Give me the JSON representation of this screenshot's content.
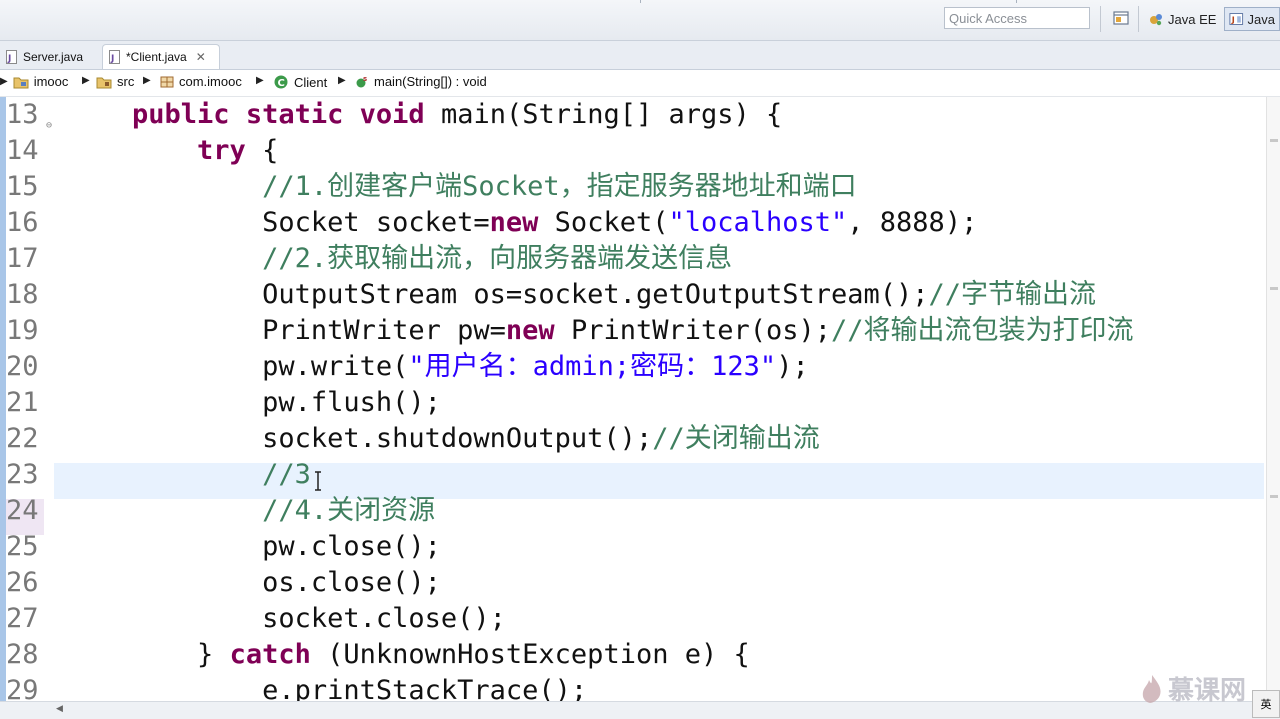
{
  "toolbar": {
    "quick_access_placeholder": "Quick Access",
    "perspectives": [
      {
        "label": "Java EE",
        "icon": "java-ee-perspective-icon",
        "active": false
      },
      {
        "label": "Java",
        "icon": "java-perspective-icon",
        "active": true
      }
    ]
  },
  "tabs": [
    {
      "label": "Server.java",
      "active": false
    },
    {
      "label": "*Client.java",
      "active": true,
      "close": "✕"
    }
  ],
  "breadcrumb": {
    "project": "imooc",
    "src": "src",
    "package": "com.imooc",
    "class": "Client",
    "method": "main(String[]) : void"
  },
  "editor": {
    "line_numbers": [
      "13",
      "14",
      "15",
      "16",
      "17",
      "18",
      "19",
      "20",
      "21",
      "22",
      "23",
      "24",
      "25",
      "26",
      "27",
      "28",
      "29"
    ],
    "lines": [
      [
        {
          "t": "    "
        },
        {
          "k": "kw",
          "t": "public"
        },
        {
          "t": " "
        },
        {
          "k": "kw",
          "t": "static"
        },
        {
          "t": " "
        },
        {
          "k": "kw",
          "t": "void"
        },
        {
          "t": " main(String[] args) {"
        }
      ],
      [
        {
          "t": "        "
        },
        {
          "k": "kw",
          "t": "try"
        },
        {
          "t": " {"
        }
      ],
      [
        {
          "t": "            "
        },
        {
          "k": "cm",
          "t": "//1.创建客户端Socket，指定服务器地址和端口"
        }
      ],
      [
        {
          "t": "            Socket socket="
        },
        {
          "k": "kw",
          "t": "new"
        },
        {
          "t": " Socket("
        },
        {
          "k": "str",
          "t": "\"localhost\""
        },
        {
          "t": ", 8888);"
        }
      ],
      [
        {
          "t": "            "
        },
        {
          "k": "cm",
          "t": "//2.获取输出流，向服务器端发送信息"
        }
      ],
      [
        {
          "t": "            OutputStream os=socket.getOutputStream();"
        },
        {
          "k": "cm",
          "t": "//字节输出流"
        }
      ],
      [
        {
          "t": "            PrintWriter pw="
        },
        {
          "k": "kw",
          "t": "new"
        },
        {
          "t": " PrintWriter(os);"
        },
        {
          "k": "cm",
          "t": "//将输出流包装为打印流"
        }
      ],
      [
        {
          "t": "            pw.write("
        },
        {
          "k": "str",
          "t": "\"用户名：admin;密码：123\""
        },
        {
          "t": ");"
        }
      ],
      [
        {
          "t": "            pw.flush();"
        }
      ],
      [
        {
          "t": "            socket.shutdownOutput();"
        },
        {
          "k": "cm",
          "t": "//关闭输出流"
        }
      ],
      [
        {
          "t": "            "
        },
        {
          "k": "cm",
          "t": "//3"
        }
      ],
      [
        {
          "t": "            "
        },
        {
          "k": "cm",
          "t": "//4.关闭资源"
        }
      ],
      [
        {
          "t": "            pw.close();"
        }
      ],
      [
        {
          "t": "            os.close();"
        }
      ],
      [
        {
          "t": "            socket.close();"
        }
      ],
      [
        {
          "t": "        } "
        },
        {
          "k": "kw",
          "t": "catch"
        },
        {
          "t": " (UnknownHostException e) {"
        }
      ],
      [
        {
          "t": "            e.printStackTrace();"
        }
      ]
    ]
  },
  "watermark": "慕课网",
  "ime": "英"
}
